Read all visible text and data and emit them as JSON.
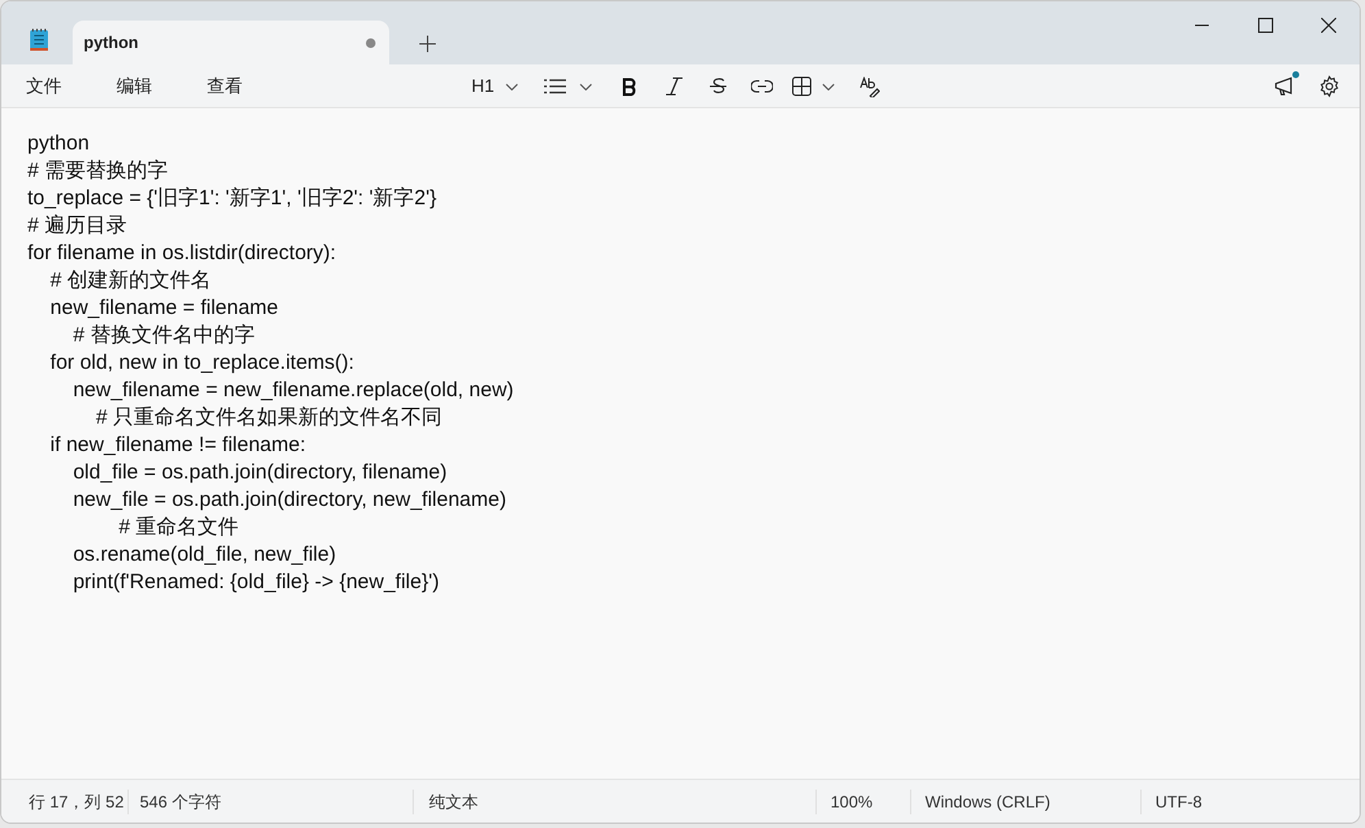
{
  "tabs": [
    {
      "label": "python",
      "selected": true,
      "modified": true
    }
  ],
  "menu": [
    "文件",
    "编辑",
    "查看"
  ],
  "toolbar": {
    "heading": "H1"
  },
  "notification_badge": true,
  "document": {
    "lines": [
      "python",
      "# 需要替换的字",
      "to_replace = {'旧字1': '新字1', '旧字2': '新字2'}",
      "# 遍历目录",
      "for filename in os.listdir(directory):",
      "    # 创建新的文件名",
      "    new_filename = filename",
      "        # 替换文件名中的字",
      "    for old, new in to_replace.items():",
      "        new_filename = new_filename.replace(old, new)",
      "            # 只重命名文件名如果新的文件名不同",
      "    if new_filename != filename:",
      "        old_file = os.path.join(directory, filename)",
      "        new_file = os.path.join(directory, new_filename)",
      "                # 重命名文件",
      "        os.rename(old_file, new_file)",
      "        print(f'Renamed: {old_file} -> {new_file}')"
    ]
  },
  "status_bar": [
    "行 17，列 52",
    "546 个字符",
    "纯文本",
    "100%",
    "Windows (CRLF)",
    "UTF-8"
  ]
}
